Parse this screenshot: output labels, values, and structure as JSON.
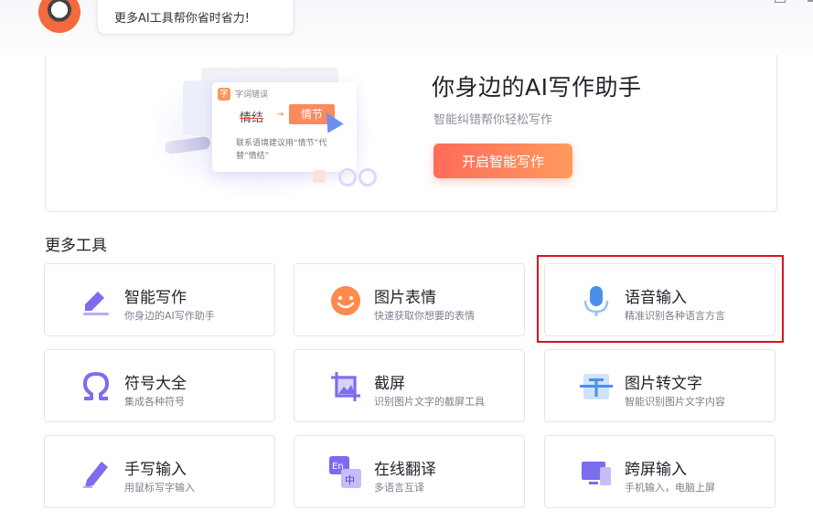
{
  "header": {
    "bubble_text": "更多AI工具帮你省时省力!"
  },
  "banner": {
    "title": "你身边的AI写作助手",
    "subtitle": "智能纠错帮你轻松写作",
    "button_label": "开启智能写作",
    "illustration": {
      "badge": "字",
      "card_title": "字词错误",
      "wrong_word": "情结",
      "arrow": "→",
      "correct_word": "情节",
      "note": "联系语境建议用“情节”代替“情结”"
    }
  },
  "more_tools": {
    "title": "更多工具",
    "tools": [
      {
        "name": "智能写作",
        "desc": "你身边的AI写作助手",
        "icon": "pen-writing-icon"
      },
      {
        "name": "图片表情",
        "desc": "快速获取你想要的表情",
        "icon": "smiley-icon"
      },
      {
        "name": "语音输入",
        "desc": "精准识别各种语言方言",
        "icon": "microphone-icon"
      },
      {
        "name": "符号大全",
        "desc": "集成各种符号",
        "icon": "omega-icon"
      },
      {
        "name": "截屏",
        "desc": "识别图片文字的截屏工具",
        "icon": "screenshot-icon"
      },
      {
        "name": "图片转文字",
        "desc": "智能识别图片文字内容",
        "icon": "image-to-text-icon"
      },
      {
        "name": "手写输入",
        "desc": "用鼠标写字输入",
        "icon": "handwriting-icon"
      },
      {
        "name": "在线翻译",
        "desc": "多语言互译",
        "icon": "translate-icon"
      },
      {
        "name": "跨屏输入",
        "desc": "手机输入，电脑上屏",
        "icon": "cross-screen-icon"
      }
    ]
  },
  "colors": {
    "accent_orange": "#ff7a5c",
    "icon_purple": "#7b6cf0",
    "icon_blue": "#4a90e8",
    "highlight_red": "#d9141b"
  }
}
